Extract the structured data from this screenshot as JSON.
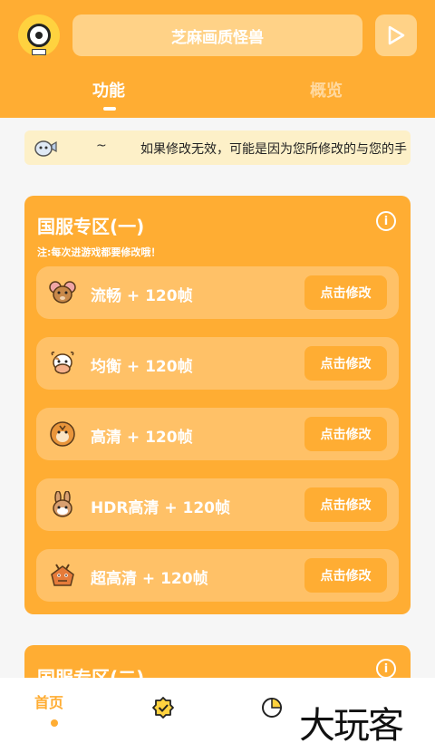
{
  "header": {
    "app_title": "芝麻画质怪兽",
    "tabs": [
      "功能",
      "概览"
    ]
  },
  "notice": {
    "prefix": "~",
    "text": "如果修改无效，可能是因为您所修改的与您的手"
  },
  "sections": [
    {
      "title": "国服专区(一)",
      "note": "注:每次进游戏都要修改哦！",
      "info_icon": "info-icon",
      "rows": [
        {
          "label": "流畅 + 120帧",
          "icon": "mouse-face-icon",
          "button": "点击修改"
        },
        {
          "label": "均衡 + 120帧",
          "icon": "cow-face-icon",
          "button": "点击修改"
        },
        {
          "label": "高清 + 120帧",
          "icon": "tiger-face-icon",
          "button": "点击修改"
        },
        {
          "label": "HDR高清 + 120帧",
          "icon": "rabbit-face-icon",
          "button": "点击修改"
        },
        {
          "label": "超高清 + 120帧",
          "icon": "dragon-face-icon",
          "button": "点击修改"
        }
      ]
    },
    {
      "title": "国服专区(二)",
      "info_icon": "info-icon"
    }
  ],
  "bottom_nav": {
    "home_label": "首页",
    "watermark": "大玩客"
  },
  "colors": {
    "accent": "#ffad33",
    "row_bg": "#ffc167",
    "title_box_bg": "#ffd287",
    "notice_bg": "#fdf0c8"
  }
}
